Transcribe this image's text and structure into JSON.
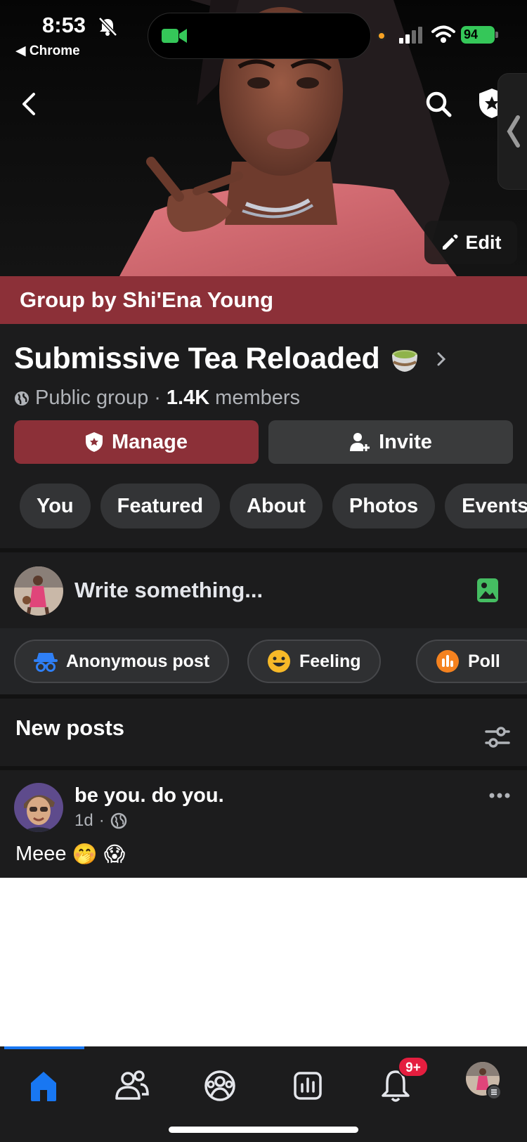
{
  "status_bar": {
    "time": "8:53",
    "back_app": "◀ Chrome",
    "battery": "94"
  },
  "header": {
    "edit_label": "Edit"
  },
  "group": {
    "owner_line": "Group by Shi'Ena Young",
    "title": "Submissive Tea Reloaded",
    "privacy": "Public group",
    "separator": "·",
    "members_count": "1.4K",
    "members_label": "members"
  },
  "actions": {
    "manage_label": "Manage",
    "invite_label": "Invite"
  },
  "tabs": [
    {
      "label": "You"
    },
    {
      "label": "Featured"
    },
    {
      "label": "About"
    },
    {
      "label": "Photos"
    },
    {
      "label": "Events"
    }
  ],
  "composer": {
    "placeholder": "Write something..."
  },
  "chips": [
    {
      "label": "Anonymous post",
      "icon": "incognito-icon"
    },
    {
      "label": "Feeling",
      "icon": "smiley-icon"
    },
    {
      "label": "Poll",
      "icon": "poll-icon"
    }
  ],
  "feed": {
    "section_title": "New posts",
    "post": {
      "author": "be you. do you.",
      "time": "1d",
      "separator": "·",
      "text": "Meee",
      "emoji": "🤭 😱"
    }
  },
  "bottom_nav": {
    "items": [
      "home-icon",
      "friends-icon",
      "groups-icon",
      "dashboard-icon",
      "notifications-icon",
      "profile-avatar"
    ],
    "notification_badge": "9+"
  },
  "colors": {
    "accent": "#8c3038",
    "blue": "#1877f2",
    "green": "#35c759"
  }
}
